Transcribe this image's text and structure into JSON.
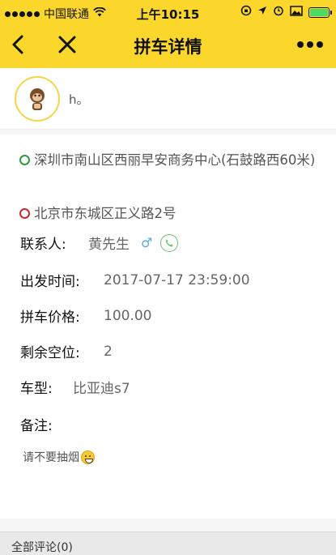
{
  "status_bar": {
    "carrier": "中国联通",
    "time": "上午10:15",
    "battery_color": "#4cd964"
  },
  "nav": {
    "title": "拼车详情",
    "back_icon": "chevron-left-icon",
    "close_icon": "close-icon",
    "more_icon": "more-icon"
  },
  "user": {
    "name": "h。"
  },
  "route": {
    "start": "深圳市南山区西丽早安商务中心(石鼓路西60米)",
    "end": "北京市东城区正义路2号"
  },
  "contact": {
    "label": "联系人:",
    "name": "黄先生",
    "gender": "♂"
  },
  "fields": {
    "departure_label": "出发时间:",
    "departure_value": "2017-07-17 23:59:00",
    "price_label": "拼车价格:",
    "price_value": "100.00",
    "seats_label": "剩余空位:",
    "seats_value": "2",
    "car_label": "车型:",
    "car_value": "比亚迪s7",
    "remark_label": "备注:",
    "remark_value": "请不要抽烟"
  },
  "comments": {
    "label": "全部评论(0)"
  },
  "colors": {
    "accent": "#fbd72b",
    "start_ring": "#2e9a3a",
    "end_ring": "#c62a2a",
    "gender": "#5aa9e6",
    "phone": "#6cc46f"
  }
}
